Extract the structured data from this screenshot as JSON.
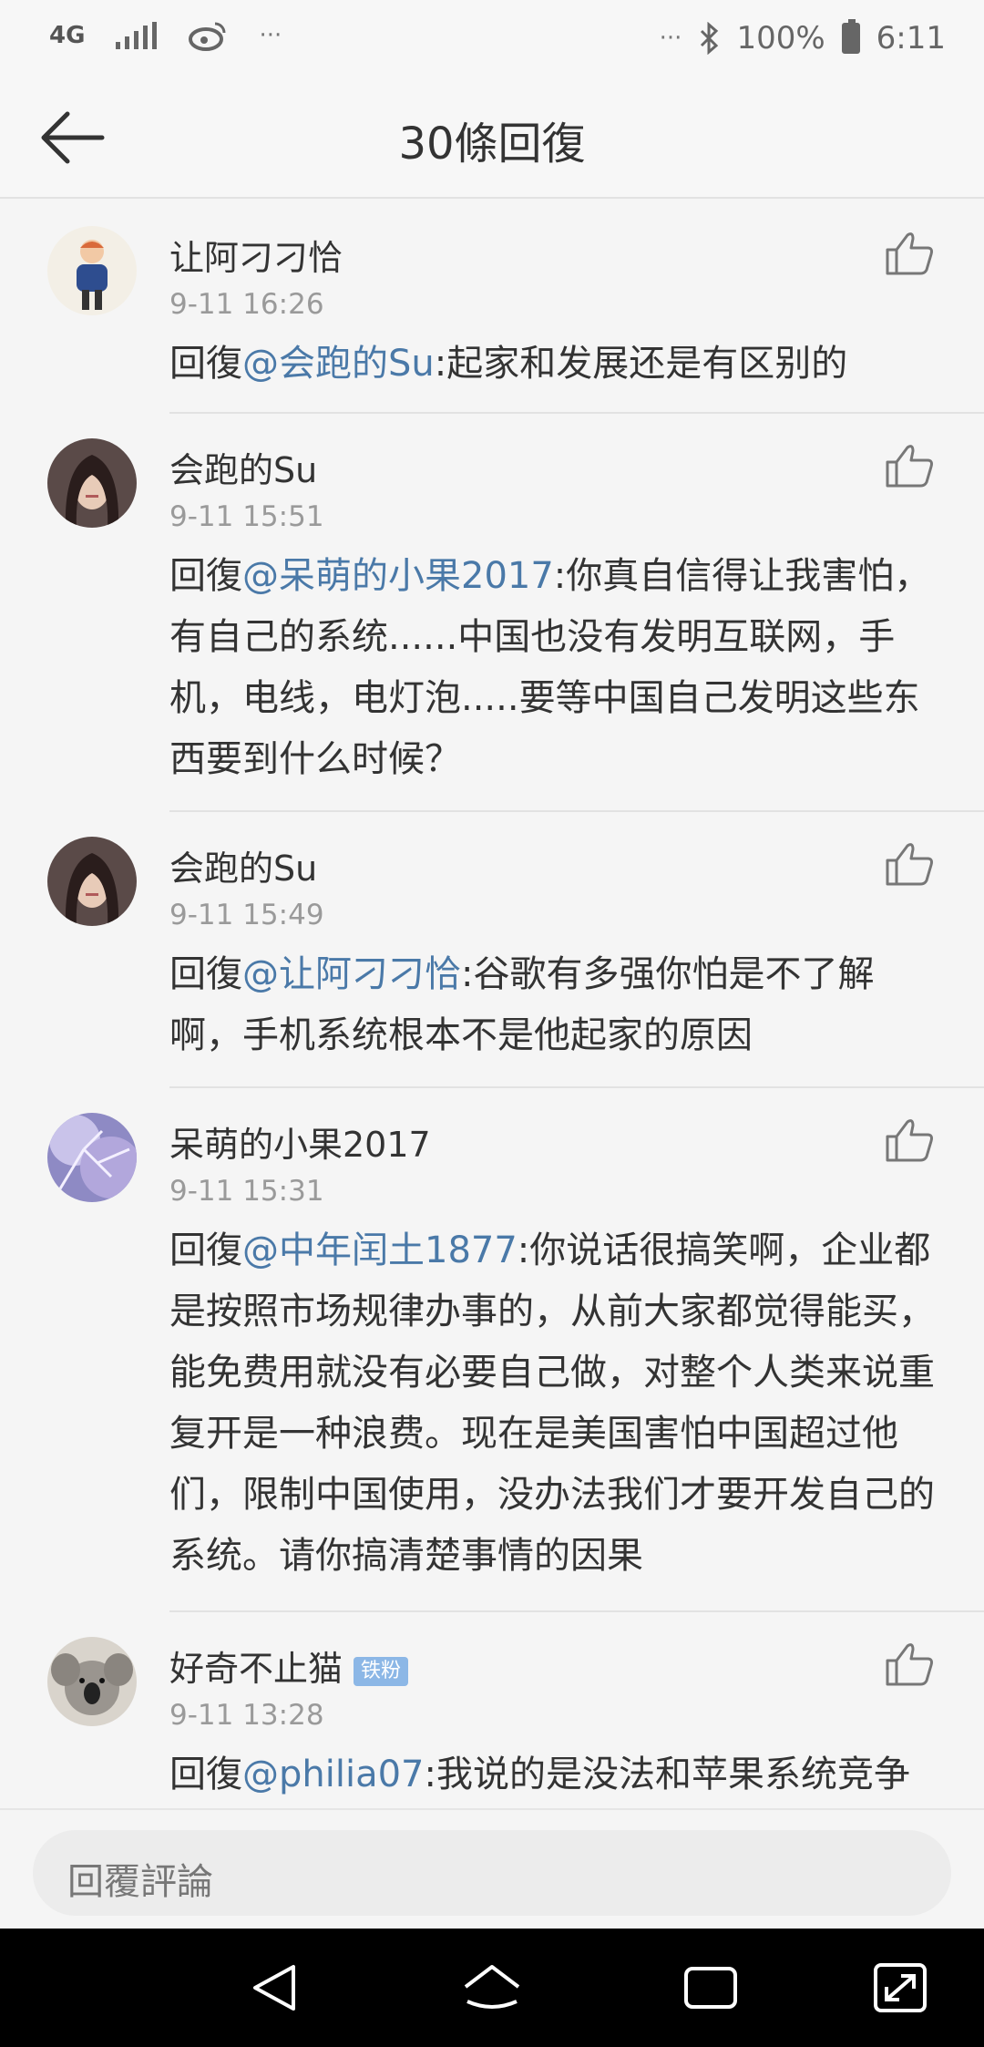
{
  "status_bar": {
    "network": "4G",
    "dots_left": "···",
    "dots_right": "···",
    "battery": "100%",
    "time": "6:11",
    "icons": [
      "network-4g-icon",
      "signal-icon",
      "weibo-icon",
      "bluetooth-icon",
      "battery-icon"
    ]
  },
  "header": {
    "title": "30條回復",
    "back_icon": "back-arrow-icon"
  },
  "comments": [
    {
      "user": "让阿刁刁恰",
      "time": "9-11 16:26",
      "prefix": "回復",
      "mention": "@会跑的Su",
      "text": ":起家和发展还是有区别的",
      "badge": ""
    },
    {
      "user": "会跑的Su",
      "time": "9-11 15:51",
      "prefix": "回復",
      "mention": "@呆萌的小果2017",
      "text": ":你真自信得让我害怕，有自己的系统......中国也没有发明互联网，手机，电线，电灯泡.....要等中国自己发明这些东西要到什么时候？",
      "badge": ""
    },
    {
      "user": "会跑的Su",
      "time": "9-11 15:49",
      "prefix": "回復",
      "mention": "@让阿刁刁恰",
      "text": ":谷歌有多强你怕是不了解啊，手机系统根本不是他起家的原因",
      "badge": ""
    },
    {
      "user": "呆萌的小果2017",
      "time": "9-11 15:31",
      "prefix": "回復",
      "mention": "@中年闰土1877",
      "text": ":你说话很搞笑啊，企业都是按照市场规律办事的，从前大家都觉得能买，能免费用就没有必要自己做，对整个人类来说重复开是一种浪费。现在是美国害怕中国超过他们，限制中国使用，没办法我们才要开发自己的系统。请你搞清楚事情的因果",
      "badge": ""
    },
    {
      "user": "好奇不止猫",
      "time": "9-11 13:28",
      "prefix": "回復",
      "mention": "@philia07",
      "text": ":我说的是没法和苹果系统竞争",
      "badge": "铁粉"
    }
  ],
  "reply_bar": {
    "placeholder": "回覆評論"
  },
  "nav_bar": {
    "icons": [
      "back-triangle-icon",
      "home-icon",
      "recents-icon",
      "expand-icon"
    ]
  },
  "colors": {
    "mention": "#4a79a8",
    "background": "#f5f5f5",
    "badge": "#8cb7e6"
  }
}
